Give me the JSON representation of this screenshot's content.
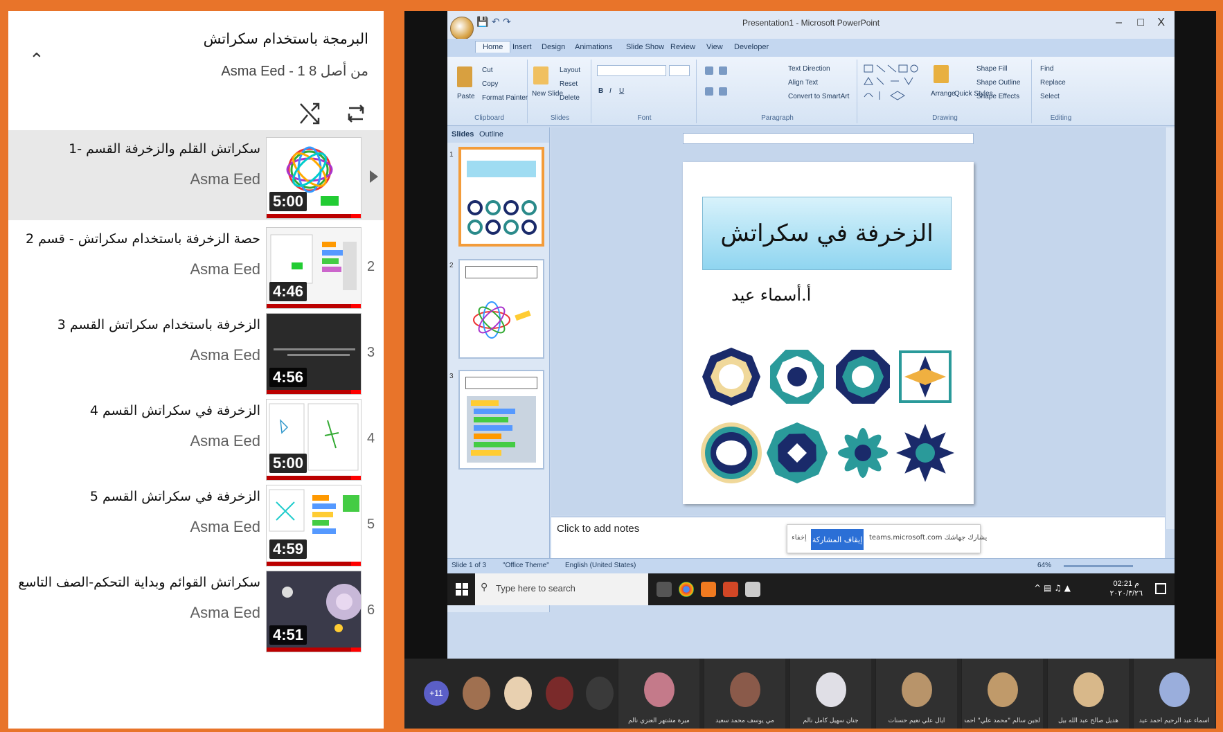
{
  "playlist": {
    "title": "البرمجة باستخدام سكراتش",
    "subtitle": "Asma Eed - 1 من أصل 8",
    "items": [
      {
        "title": "سكراتش القلم والزخرفة القسم -1",
        "author": "Asma Eed",
        "duration": "5:00",
        "index": "",
        "active": true
      },
      {
        "title": "حصة الزخرفة باستخدام سكراتش - قسم 2",
        "author": "Asma Eed",
        "duration": "4:46",
        "index": "2"
      },
      {
        "title": "الزخرفة باستخدام سكراتش القسم 3",
        "author": "Asma Eed",
        "duration": "4:56",
        "index": "3"
      },
      {
        "title": "الزخرفة في سكراتش القسم 4",
        "author": "Asma Eed",
        "duration": "5:00",
        "index": "4"
      },
      {
        "title": "الزخرفة في سكراتش القسم 5",
        "author": "Asma Eed",
        "duration": "4:59",
        "index": "5"
      },
      {
        "title": "سكراتش القوائم وبداية التحكم-الصف التاسع",
        "author": "Asma Eed",
        "duration": "4:51",
        "index": "6"
      }
    ]
  },
  "ppt": {
    "window_title": "Presentation1 - Microsoft PowerPoint",
    "window_min": "–",
    "window_max": "□",
    "window_close": "X",
    "tabs": [
      "Home",
      "Insert",
      "Design",
      "Animations",
      "Slide Show",
      "Review",
      "View",
      "Developer"
    ],
    "ribbon": {
      "clipboard": {
        "label": "Clipboard",
        "paste": "Paste",
        "cut": "Cut",
        "copy": "Copy",
        "format_painter": "Format Painter"
      },
      "slides": {
        "label": "Slides",
        "new_slide": "New Slide",
        "layout": "Layout",
        "reset": "Reset",
        "delete": "Delete"
      },
      "font": {
        "label": "Font"
      },
      "paragraph": {
        "label": "Paragraph",
        "text_direction": "Text Direction",
        "align_text": "Align Text",
        "convert": "Convert to SmartArt"
      },
      "drawing": {
        "label": "Drawing",
        "arrange": "Arrange",
        "quick_styles": "Quick Styles",
        "shape_fill": "Shape Fill",
        "shape_outline": "Shape Outline",
        "shape_effects": "Shape Effects"
      },
      "editing": {
        "label": "Editing",
        "find": "Find",
        "replace": "Replace",
        "select": "Select"
      }
    },
    "pane_tabs": [
      "Slides",
      "Outline"
    ],
    "slide_numbers": [
      "1",
      "2",
      "3"
    ],
    "slide_title": "الزخرفة في سكراتش",
    "slide_author": "أ.أسماء عيد",
    "notes_placeholder": "Click to add notes",
    "share_bar": {
      "hide": "إخفاء",
      "stop": "إيقاف المشاركة",
      "text": "يشارك جهاشك teams.microsoft.com"
    },
    "status": {
      "slide": "Slide 1 of 3",
      "theme": "\"Office Theme\"",
      "language": "English (United States)",
      "zoom": "64%"
    },
    "taskbar": {
      "search_placeholder": "Type here to search",
      "time": "02:21 م",
      "date": "٢٠٢٠/٣/٢٦"
    }
  },
  "participants": {
    "overflow": "+11",
    "tiles": [
      {
        "name": "ميرة مشتهر العنزي نالم",
        "color": "#c47a8a"
      },
      {
        "name": "مي يوسف محمد سعيد",
        "color": "#8a5a4a"
      },
      {
        "name": "جنان سهيل كامل نالم",
        "color": "#e0dfe6"
      },
      {
        "name": "أيال علي نعيم حسنات",
        "color": "#b8946a"
      },
      {
        "name": "لجين سالم \"محمد علي\" أحمد",
        "color": "#c09a6a"
      },
      {
        "name": "هديل صالح عبد الله بيل",
        "color": "#d8b88a"
      },
      {
        "name": "أسماء عبد الرحيم أحمد عيد",
        "color": "#9aaedc"
      }
    ]
  },
  "colors": {
    "frame": "#e8742a",
    "playlist_active": "#e8e8e8",
    "progress_red": "#ff0000",
    "teams_purple": "#5b5fc7"
  }
}
